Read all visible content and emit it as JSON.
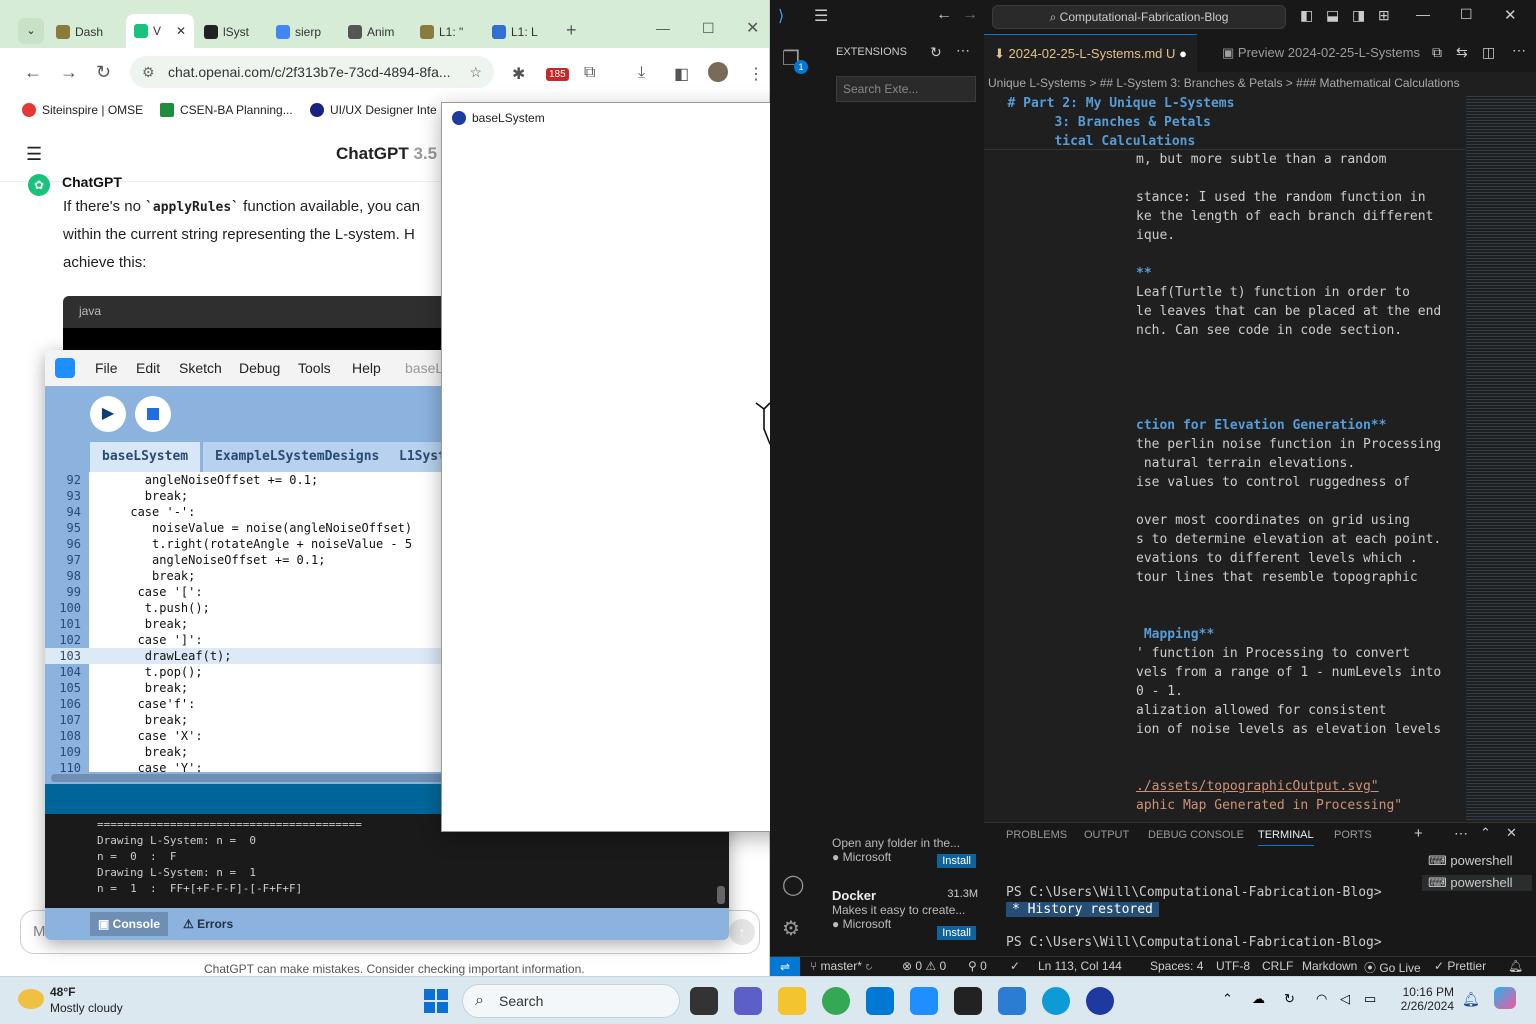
{
  "chrome": {
    "tabs": [
      {
        "label": "Dash",
        "color": "#8a7a3e"
      },
      {
        "label": "V",
        "color": "#19c37d"
      },
      {
        "label": "lSyst",
        "color": "#222222"
      },
      {
        "label": "sierp",
        "color": "#4285f4"
      },
      {
        "label": "Anim",
        "color": "#555555"
      },
      {
        "label": "L1: \"",
        "color": "#8a7a3e"
      },
      {
        "label": "L1: L",
        "color": "#2f6fd6"
      }
    ],
    "url": "chat.openai.com/c/2f313b7e-73cd-4894-8fa...",
    "ext_badge": "185",
    "bookmarks": [
      {
        "label": "Siteinspire | OMSE",
        "color": "#e53935"
      },
      {
        "label": "CSEN-BA Planning...",
        "color": "#1e8e3e"
      },
      {
        "label": "UI/UX Designer Inte",
        "color": "#1a237e"
      }
    ]
  },
  "chatgpt": {
    "title": "ChatGPT",
    "version": "3.5",
    "author": "ChatGPT",
    "line1_pre": "If there's no ",
    "line1_code": "`applyRules`",
    "line1_post": " function available, you can",
    "line2": "within the current string representing the L-system. H",
    "line3": "achieve this:",
    "code_lang": "java",
    "input_prefix": "M",
    "footer": "ChatGPT can make mistakes. Consider checking important information."
  },
  "processing": {
    "menus": [
      "File",
      "Edit",
      "Sketch",
      "Debug",
      "Tools",
      "Help",
      "baseL"
    ],
    "tabs": [
      "baseLSystem",
      "ExampleLSystemDesigns",
      "L1Syst"
    ],
    "code": [
      {
        "n": "92",
        "t": "        angleNoiseOffset += 0.1;"
      },
      {
        "n": "93",
        "t": "        break;"
      },
      {
        "n": "94",
        "t": "      case '-':"
      },
      {
        "n": "95",
        "t": "         noiseValue = noise(angleNoiseOffset)"
      },
      {
        "n": "96",
        "t": "         t.right(rotateAngle + noiseValue - 5"
      },
      {
        "n": "97",
        "t": "         angleNoiseOffset += 0.1;"
      },
      {
        "n": "98",
        "t": "         break;"
      },
      {
        "n": "99",
        "t": "       case '[':"
      },
      {
        "n": "100",
        "t": "        t.push();"
      },
      {
        "n": "101",
        "t": "        break;"
      },
      {
        "n": "102",
        "t": "       case ']':"
      },
      {
        "n": "103",
        "t": "        drawLeaf(t);"
      },
      {
        "n": "104",
        "t": "        t.pop();"
      },
      {
        "n": "105",
        "t": "        break;"
      },
      {
        "n": "106",
        "t": "       case'f':"
      },
      {
        "n": "107",
        "t": "        break;"
      },
      {
        "n": "108",
        "t": "       case 'X':"
      },
      {
        "n": "109",
        "t": "        break;"
      },
      {
        "n": "110",
        "t": "       case 'Y':"
      }
    ],
    "console": [
      "========================================",
      "Drawing L-System: n =  0",
      "n =  0  :  F",
      "Drawing L-System: n =  1",
      "n =  1  :  FF+[+F-F-F]-[-F+F+F]"
    ],
    "console_tab": "Console",
    "errors_tab": "Errors"
  },
  "sketch": {
    "title": "baseLSystem"
  },
  "vscode": {
    "search": "Computational-Fabrication-Blog",
    "ext_title": "EXTENSIONS",
    "ext_search_placeholder": "Search Exte...",
    "ext1": {
      "desc": "Open any folder in the...",
      "publisher": "Microsoft",
      "action": "Install"
    },
    "ext2": {
      "title": "Docker",
      "downloads": "31.3M",
      "desc": "Makes it easy to create...",
      "publisher": "Microsoft",
      "action": "Install"
    },
    "tab_active": "2024-02-25-L-Systems.md",
    "tab_active_status": "U",
    "tab_preview": "Preview 2024-02-25-L-Systems",
    "breadcrumb": "Unique L-Systems > ## L-System 3: Branches & Petals > ### Mathematical Calculations",
    "sticky": [
      "   # Part 2: My Unique L-Systems",
      "         3: Branches & Petals",
      "         tical Calculations"
    ],
    "lines": [
      {
        "t": "m, but more subtle than a random",
        "c": ""
      },
      {
        "t": "",
        "c": ""
      },
      {
        "t": "stance: I used the random function in",
        "c": ""
      },
      {
        "t": "ke the length of each branch different",
        "c": ""
      },
      {
        "t": "ique.",
        "c": ""
      },
      {
        "t": "",
        "c": ""
      },
      {
        "t": "**",
        "c": "h"
      },
      {
        "t": "Leaf(Turtle t) function in order to",
        "c": ""
      },
      {
        "t": "le leaves that can be placed at the end",
        "c": ""
      },
      {
        "t": "nch. Can see code in code section.",
        "c": ""
      },
      {
        "t": "",
        "c": ""
      },
      {
        "t": "",
        "c": ""
      },
      {
        "t": "",
        "c": ""
      },
      {
        "t": "",
        "c": ""
      },
      {
        "t": "ction for Elevation Generation**",
        "c": "h"
      },
      {
        "t": "the perlin noise function in Processing",
        "c": ""
      },
      {
        "t": " natural terrain elevations.",
        "c": ""
      },
      {
        "t": "ise values to control ruggedness of",
        "c": ""
      },
      {
        "t": "",
        "c": ""
      },
      {
        "t": "over most coordinates on grid using",
        "c": ""
      },
      {
        "t": "s to determine elevation at each point.",
        "c": ""
      },
      {
        "t": "evations to different levels which .",
        "c": ""
      },
      {
        "t": "tour lines that resemble topographic",
        "c": ""
      },
      {
        "t": "",
        "c": ""
      },
      {
        "t": "",
        "c": ""
      },
      {
        "t": " Mapping**",
        "c": "h"
      },
      {
        "t": "' function in Processing to convert",
        "c": ""
      },
      {
        "t": "vels from a range of 1 - numLevels into",
        "c": ""
      },
      {
        "t": "0 - 1.",
        "c": ""
      },
      {
        "t": "alization allowed for consistent",
        "c": ""
      },
      {
        "t": "ion of noise levels as elevation levels",
        "c": ""
      },
      {
        "t": "",
        "c": ""
      },
      {
        "t": "",
        "c": ""
      },
      {
        "t": "./assets/topographicOutput.svg\"",
        "c": "link"
      },
      {
        "t": "aphic Map Generated in Processing\"",
        "c": "str"
      }
    ],
    "panel_tabs": [
      "PROBLEMS",
      "OUTPUT",
      "DEBUG CONSOLE",
      "TERMINAL",
      "PORTS"
    ],
    "terminal": {
      "prompt1": "PS C:\\Users\\Will\\Computational-Fabrication-Blog>",
      "restored": "History restored",
      "prompt2": "PS C:\\Users\\Will\\Computational-Fabrication-Blog>"
    },
    "shells": [
      "powershell",
      "powershell"
    ],
    "status": {
      "branch": "master*",
      "errors": "0",
      "warnings": "0",
      "ports": "0",
      "position": "Ln 113, Col 144",
      "spaces": "Spaces: 4",
      "encoding": "UTF-8",
      "eol": "CRLF",
      "lang": "Markdown",
      "golive": "Go Live",
      "prettier": "Prettier"
    }
  },
  "taskbar": {
    "temp": "48°F",
    "weather": "Mostly cloudy",
    "search": "Search",
    "time": "10:16 PM",
    "date": "2/26/2024"
  }
}
